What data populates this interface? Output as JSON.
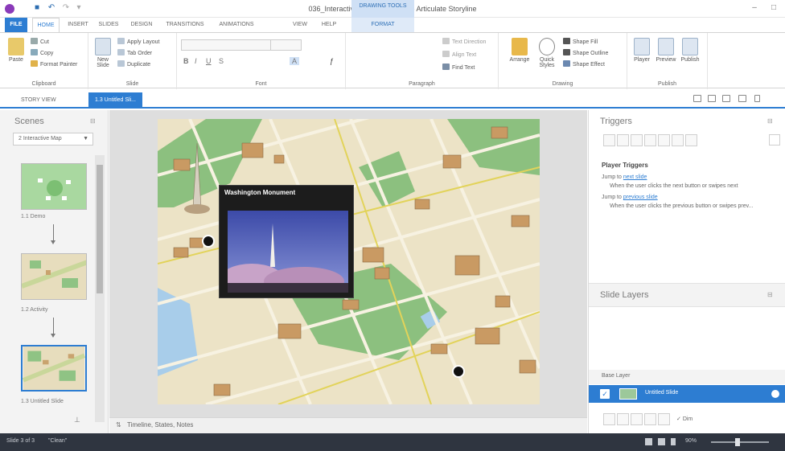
{
  "window": {
    "title": "036_Interactive_Maelann.story* - Articulate Storyline",
    "context_group": "DRAWING TOOLS"
  },
  "ribbon": {
    "tabs": [
      "FILE",
      "HOME",
      "INSERT",
      "SLIDES",
      "DESIGN",
      "TRANSITIONS",
      "ANIMATIONS",
      "VIEW",
      "HELP",
      "FORMAT"
    ],
    "clipboard": {
      "paste": "Paste",
      "cut": "Cut",
      "copy": "Copy",
      "format_painter": "Format Painter",
      "label": "Clipboard"
    },
    "slide": {
      "new_slide": "New Slide",
      "apply_layout": "Apply Layout",
      "duplicate_hdr": "Tab Order",
      "duplicate": "Duplicate",
      "label": "Slide"
    },
    "font": {
      "label": "Font"
    },
    "paragraph": {
      "text_direction": "Text Direction",
      "align_text": "Align Text",
      "find_text": "Find Text",
      "label": "Paragraph"
    },
    "drawing": {
      "arrange": "Arrange",
      "quick_styles": "Quick Styles",
      "shape_fill": "Shape Fill",
      "shape_outline": "Shape Outline",
      "shape_effect": "Shape Effect",
      "label": "Drawing"
    },
    "publish": {
      "player": "Player",
      "preview": "Preview",
      "publish": "Publish",
      "label": "Publish"
    }
  },
  "doc_tabs": {
    "story_view": "STORY VIEW",
    "active_slide": "1.3 Untitled Sli..."
  },
  "scenes": {
    "title": "Scenes",
    "selector": "2 Interactive Map",
    "thumbnails": [
      {
        "label": "1.1 Demo"
      },
      {
        "label": "1.2 Activity"
      },
      {
        "label": "1.3 Untitled Slide"
      }
    ]
  },
  "stage": {
    "footer_label": "Timeline, States, Notes",
    "popup_title": "Washington Monument"
  },
  "triggers": {
    "title": "Triggers",
    "player_triggers_title": "Player Triggers",
    "items": [
      {
        "prefix": "Jump to ",
        "link": "next slide",
        "condition": "When the user clicks the next button or swipes next"
      },
      {
        "prefix": "Jump to ",
        "link": "previous slide",
        "condition": "When the user clicks the previous button or swipes prev..."
      }
    ]
  },
  "slide_layers": {
    "title": "Slide Layers",
    "base_layer_label": "Base Layer",
    "layer_name": "Untitled Slide",
    "dim_label": "Dim"
  },
  "status_bar": {
    "slide_info": "Slide 3 of 3",
    "theme": "\"Clean\"",
    "zoom": "90%"
  },
  "colors": {
    "accent": "#2d7dd2",
    "statusbar": "#2f3540",
    "map_land": "#ece3c6",
    "map_park": "#8cc07f"
  }
}
